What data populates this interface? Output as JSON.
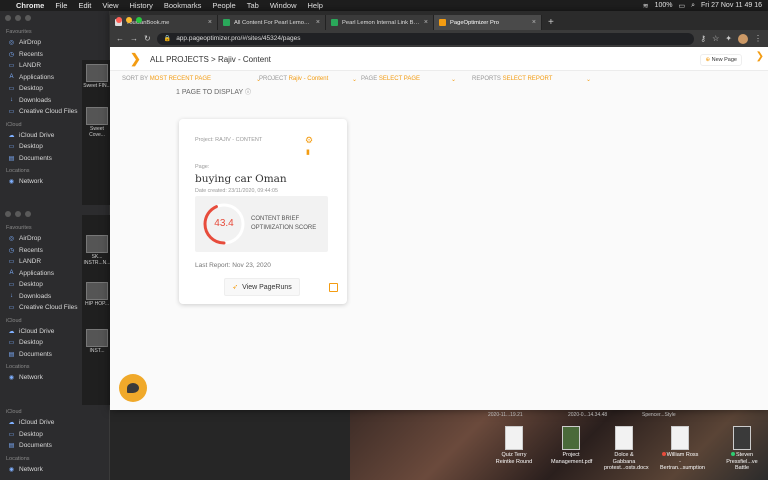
{
  "menubar": {
    "app": "Chrome",
    "items": [
      "File",
      "Edit",
      "View",
      "History",
      "Bookmarks",
      "People",
      "Tab",
      "Window",
      "Help"
    ],
    "battery": "100%",
    "clock": "Fri 27 Nov  11 49 16"
  },
  "finder": {
    "sections": [
      {
        "title": "Favourites",
        "items": [
          "AirDrop",
          "Recents",
          "LANDR",
          "Applications",
          "Desktop",
          "Downloads",
          "Creative Cloud Files"
        ]
      },
      {
        "title": "iCloud",
        "items": [
          "iCloud Drive",
          "Desktop",
          "Documents"
        ]
      },
      {
        "title": "Locations",
        "items": [
          "Network"
        ]
      }
    ],
    "thumbs1": [
      "Sweet FIN...",
      "Sweet Cove..."
    ],
    "thumbs2": [
      "SK... INSTR...N...",
      "HIP HOP...",
      "INST..."
    ]
  },
  "tabs": [
    {
      "label": "YouCanBook.me",
      "active": false
    },
    {
      "label": "All Content For Pearl Lemon –",
      "active": false
    },
    {
      "label": "Pearl Lemon Internal Link Buildi...",
      "active": false
    },
    {
      "label": "PageOptimizer Pro",
      "active": true
    }
  ],
  "url": "app.pageoptimizer.pro/#/sites/45324/pages",
  "breadcrumb": "ALL PROJECTS > Rajiv - Content",
  "new_page": "New Page",
  "filters": {
    "sort_label": "SORT BY",
    "sort_value": "MOST RECENT PAGE",
    "project_label": "PROJECT",
    "project_value": "Rajiv - Content",
    "page_label": "PAGE",
    "page_value": "SELECT PAGE",
    "reports_label": "REPORTS",
    "reports_value": "SELECT REPORT"
  },
  "page_count": "1 PAGE TO DISPLAY",
  "card": {
    "project": "Project: RAJIV - CONTENT",
    "page_label": "Page:",
    "keyword": "buying car Oman",
    "date_created": "Date created: 23/11/2020, 09:44:05",
    "score": "43.4",
    "score_fraction": 0.434,
    "score_label_1": "CONTENT BRIEF",
    "score_label_2": "OPTIMIZATION SCORE",
    "last_report": "Last Report: Nov 23, 2020",
    "run_button": "View PageRuns"
  },
  "desktop_files": [
    {
      "label": "Quiz Terry Reintke Round"
    },
    {
      "label": "Project Management.pdf"
    },
    {
      "label": "Dolce & Gabbana protest...osts.docx"
    },
    {
      "label": "William Ross - Bertran...sumption"
    },
    {
      "label": "Steven Pressfiel...ve Battle"
    }
  ],
  "desktop_top": [
    "2020-11...19.21",
    "2020-0...14.34.48",
    "Spencer...Style"
  ]
}
